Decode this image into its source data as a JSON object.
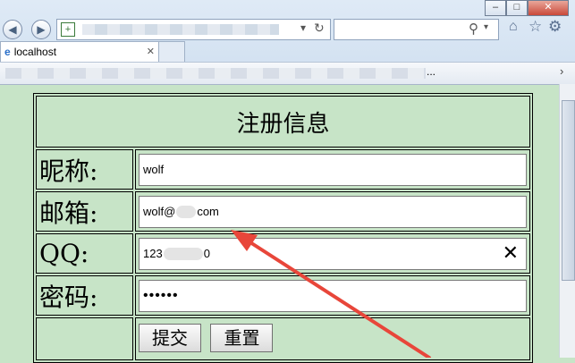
{
  "browser": {
    "tab_title": "localhost",
    "search_icon_glyph": "⚲",
    "refresh_glyph": "↻",
    "stop_glyph": "▾",
    "favorites_more": "..."
  },
  "form": {
    "title": "注册信息",
    "nickname": {
      "label": "昵称:",
      "value": "wolf"
    },
    "email": {
      "label": "邮箱:",
      "value_prefix": "wolf@",
      "value_suffix": "com"
    },
    "qq": {
      "label": "QQ:",
      "value_prefix": "123",
      "value_suffix": "0"
    },
    "password": {
      "label": "密码:",
      "value": "••••••"
    },
    "submit_label": "提交",
    "reset_label": "重置"
  },
  "colors": {
    "page_bg": "#c7e4c7",
    "arrow": "#e8463a"
  }
}
